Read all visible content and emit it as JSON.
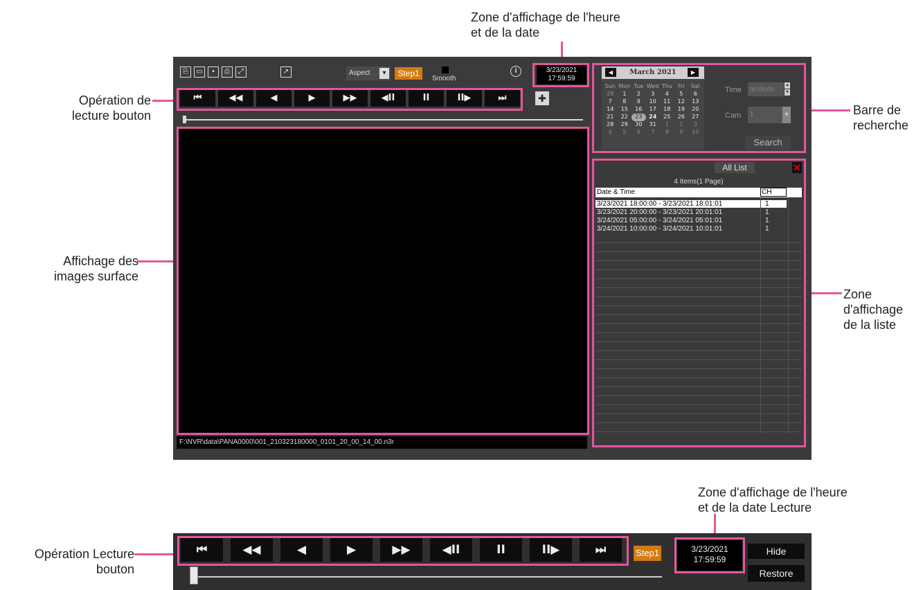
{
  "callouts": {
    "datetime_zone": "Zone d'affichage de l'heure\net de la date",
    "playback_buttons": "Opération de\nlecture bouton",
    "search_bar": "Barre de\nrecherche",
    "image_display": "Affichage des\nimages surface",
    "list_zone": "Zone\nd'affichage\nde la liste",
    "datetime_playback_zone": "Zone d'affichage de l'heure\net de la date Lecture",
    "bottom_playback_buttons": "Opération Lecture\nbouton"
  },
  "toolbar": {
    "aspect_label": "Aspect",
    "step_label": "Step1",
    "smooth_label": "Smooth",
    "info_icon": "info-icon"
  },
  "datetime": {
    "date": "3/23/2021",
    "time": "17:59:59"
  },
  "playback_buttons": [
    "⏮",
    "◀◀",
    "◀",
    "▶",
    "▶▶",
    "◀II",
    "II",
    "II▶",
    "⏭"
  ],
  "file_path": "F:\\NVR\\data\\PANA0000\\001_210323180000_0101_20_00_14_00.n3r",
  "calendar": {
    "month_label": "March 2021",
    "weekdays": [
      "Sun",
      "Mon",
      "Tue",
      "Wed",
      "Thu",
      "Fri",
      "Sat"
    ],
    "weeks": [
      [
        "28",
        "1",
        "2",
        "3",
        "4",
        "5",
        "6"
      ],
      [
        "7",
        "8",
        "9",
        "10",
        "11",
        "12",
        "13"
      ],
      [
        "14",
        "15",
        "16",
        "17",
        "18",
        "19",
        "20"
      ],
      [
        "21",
        "22",
        "23",
        "24",
        "25",
        "26",
        "27"
      ],
      [
        "28",
        "29",
        "30",
        "31",
        "1",
        "2",
        "3"
      ],
      [
        "4",
        "5",
        "6",
        "7",
        "8",
        "9",
        "10"
      ]
    ],
    "selected_day": "23"
  },
  "search": {
    "time_label": "Time",
    "time_value": "00:00:00",
    "cam_label": "Cam",
    "cam_value": "1",
    "search_label": "Search"
  },
  "list": {
    "tab_label": "All List",
    "count_label": "4 Items(1 Page)",
    "col_datetime": "Date & Time",
    "col_ch": "CH",
    "rows": [
      {
        "datetime": "3/23/2021 18:00:00 - 3/23/2021 18:01:01",
        "ch": "1"
      },
      {
        "datetime": "3/23/2021 20:00:00 - 3/23/2021 20:01:01",
        "ch": "1"
      },
      {
        "datetime": "3/24/2021 05:00:00 - 3/24/2021 05:01:01",
        "ch": "1"
      },
      {
        "datetime": "3/24/2021 10:00:00 - 3/24/2021 10:01:01",
        "ch": "1"
      }
    ]
  },
  "bottom": {
    "step_label": "Step1",
    "date": "3/23/2021",
    "time": "17:59:59",
    "hide_label": "Hide",
    "restore_label": "Restore"
  },
  "colors": {
    "highlight": "#e4569a",
    "step_orange": "#d37a12",
    "window_bg": "#3b3b3b"
  }
}
